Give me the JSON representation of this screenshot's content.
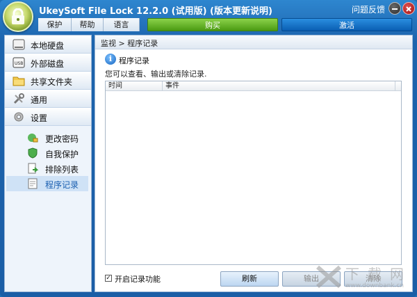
{
  "window": {
    "title": "UkeySoft File Lock 12.2.0 (试用版) (版本更新说明)",
    "feedback": "问题反馈",
    "minimize_icon": "minus",
    "close_icon": "x"
  },
  "menu": {
    "protect": "保护",
    "help": "帮助",
    "language": "语言",
    "buy": "购买",
    "activate": "激活"
  },
  "sidebar": {
    "items": [
      {
        "label": "本地硬盘",
        "icon": "hard-drive-icon"
      },
      {
        "label": "外部磁盘",
        "icon": "usb-icon"
      },
      {
        "label": "共享文件夹",
        "icon": "shared-folder-icon"
      },
      {
        "label": "通用",
        "icon": "tools-icon"
      },
      {
        "label": "设置",
        "icon": "gear-icon"
      }
    ],
    "settings_items": [
      {
        "label": "更改密码",
        "icon": "key-icon"
      },
      {
        "label": "自我保护",
        "icon": "shield-icon"
      },
      {
        "label": "排除列表",
        "icon": "exclusion-list-icon"
      },
      {
        "label": "程序记录",
        "icon": "log-icon",
        "active": true
      }
    ]
  },
  "content": {
    "breadcrumb": "监视 > 程序记录",
    "section_title": "程序记录",
    "section_desc": "您可以查看、输出或清除记录.",
    "table": {
      "columns": [
        "时间",
        "事件"
      ],
      "rows": []
    },
    "enable_log": {
      "label": "开启记录功能",
      "checked": true,
      "mark": "✓"
    },
    "buttons": {
      "refresh": "刷新",
      "export": "输出",
      "clear": "清除"
    }
  },
  "watermark": {
    "text": "下载网",
    "url": "www.downbank.cn"
  },
  "colors": {
    "titlebar": "#1d64ad",
    "buy": "#4a9a12",
    "activate": "#0a5eb2"
  }
}
